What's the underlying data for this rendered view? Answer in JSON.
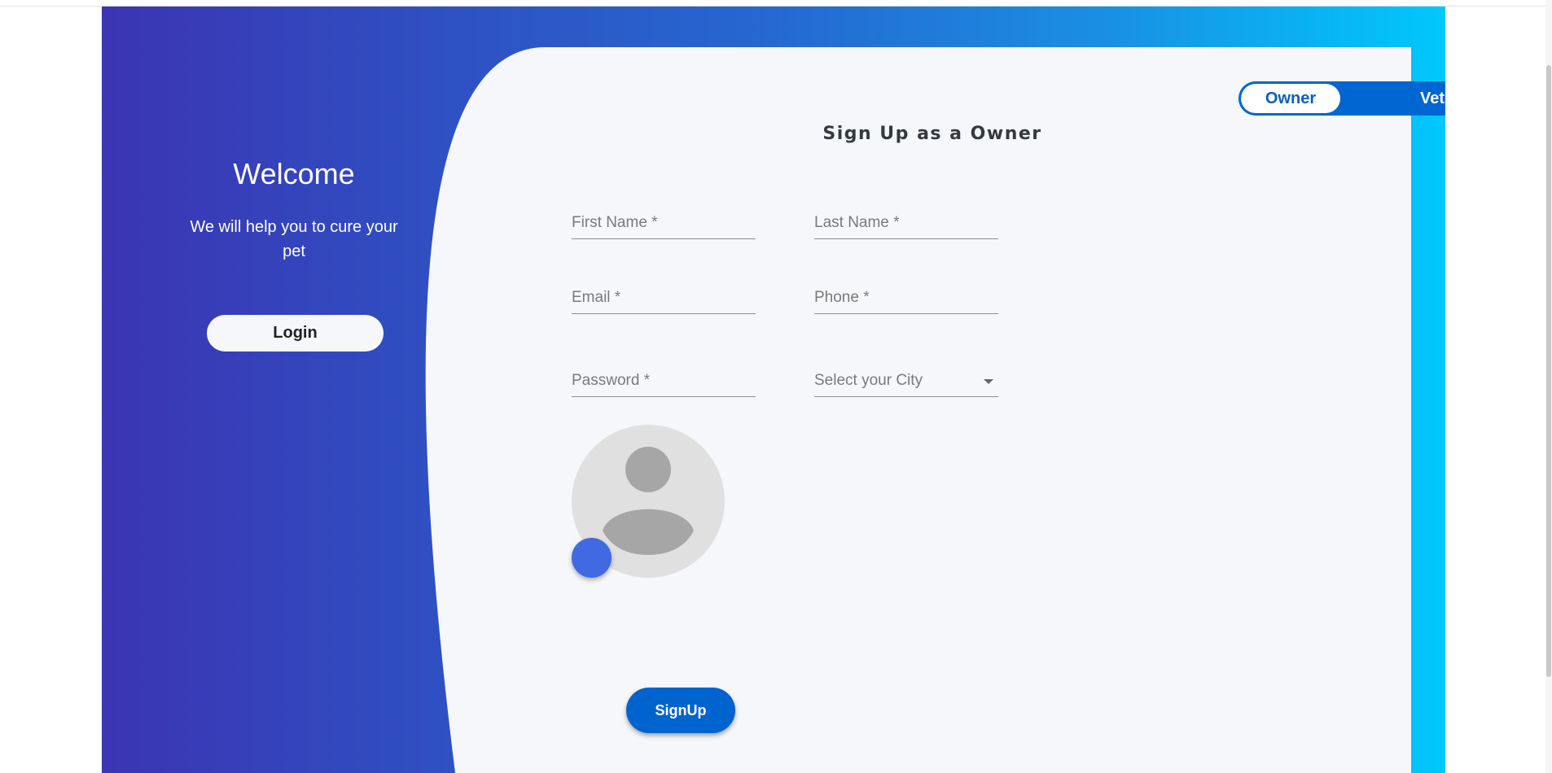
{
  "welcome": {
    "title": "Welcome",
    "subtitle": "We will help you to cure your pet",
    "login_label": "Login"
  },
  "role_toggle": {
    "options": [
      "Owner",
      "Vet"
    ],
    "selected": "Owner"
  },
  "form": {
    "title": "Sign Up as a Owner",
    "fields": {
      "first_name": {
        "placeholder": "First Name *"
      },
      "last_name": {
        "placeholder": "Last Name *"
      },
      "email": {
        "placeholder": "Email *"
      },
      "phone": {
        "placeholder": "Phone *"
      },
      "password": {
        "placeholder": "Password *"
      },
      "city": {
        "placeholder": "Select your City"
      }
    },
    "signup_label": "SignUp"
  },
  "colors": {
    "gradient_start": "#3b34b3",
    "gradient_end": "#00c8fd",
    "card_bg": "#f5f7fa",
    "primary": "#0064cf",
    "upload_button": "#4169e1"
  }
}
